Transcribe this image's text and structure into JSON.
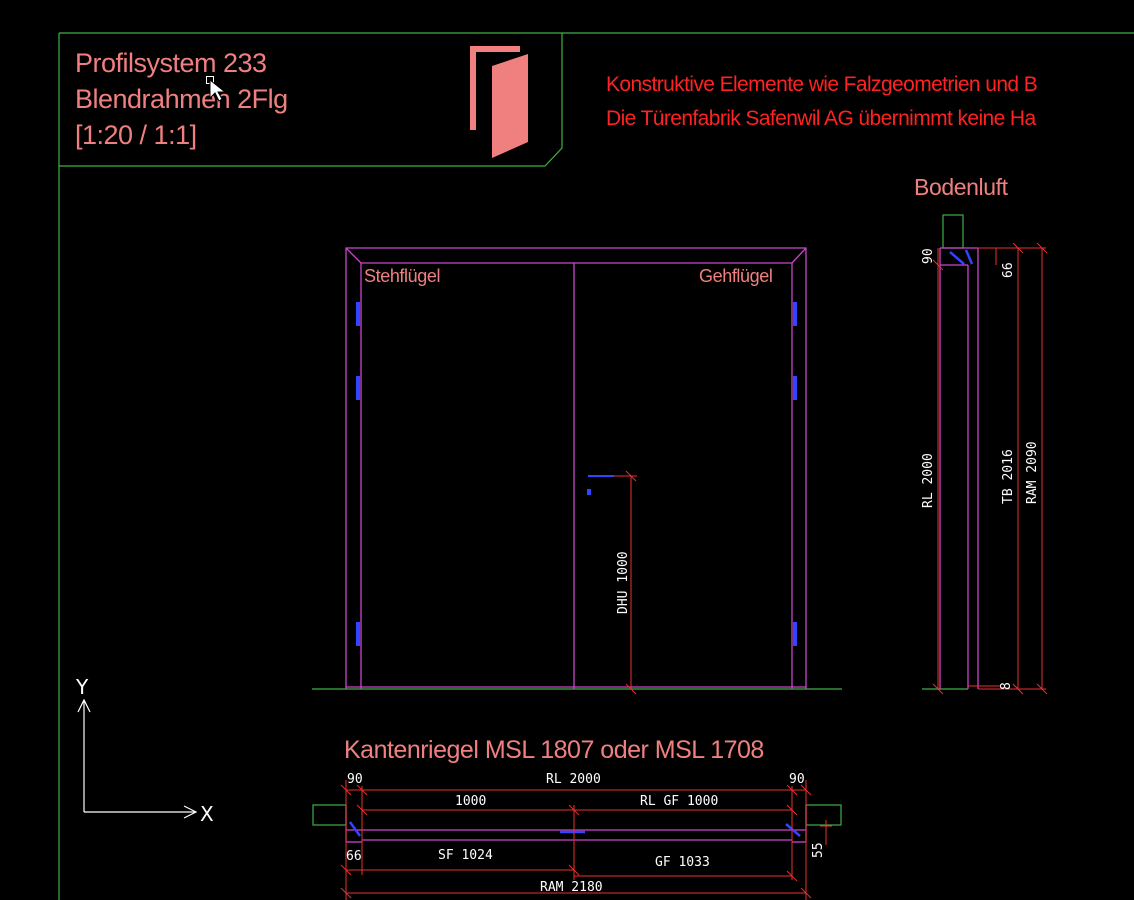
{
  "title_block": {
    "line1": "Profilsystem 233",
    "line2": "Blendrahmen 2Flg",
    "line3": "[1:20 / 1:1]"
  },
  "warning": {
    "line1": "Konstruktive Elemente wie Falzgeometrien und B",
    "line2": "Die Türenfabrik Safenwil AG übernimmt keine Ha"
  },
  "elevation": {
    "left_leaf": "Stehflügel",
    "right_leaf": "Gehflügel",
    "dhu_dim": "DHU 1000"
  },
  "section_vertical": {
    "title": "Bodenluft",
    "dim_90": "90",
    "dim_66": "66",
    "dim_8": "8",
    "dim_rl": "RL 2000",
    "dim_tb": "TB 2016",
    "dim_ram": "RAM 2090"
  },
  "section_horizontal": {
    "title": "Kantenriegel MSL 1807 oder MSL 1708",
    "dim_90_left": "90",
    "dim_rl": "RL 2000",
    "dim_90_right": "90",
    "dim_1000": "1000",
    "dim_rl_gf": "RL GF 1000",
    "dim_66": "66",
    "dim_sf": "SF 1024",
    "dim_gf": "GF 1033",
    "dim_55": "55",
    "dim_ram": "RAM 2180"
  },
  "ucs": {
    "x_label": "X",
    "y_label": "Y"
  },
  "colors": {
    "background": "#000000",
    "border": "#3cb043",
    "frame": "#cc44cc",
    "dimension": "#e83030",
    "text_pink": "#f08080",
    "warning_red": "#ff2222",
    "hardware_blue": "#3344ff"
  }
}
